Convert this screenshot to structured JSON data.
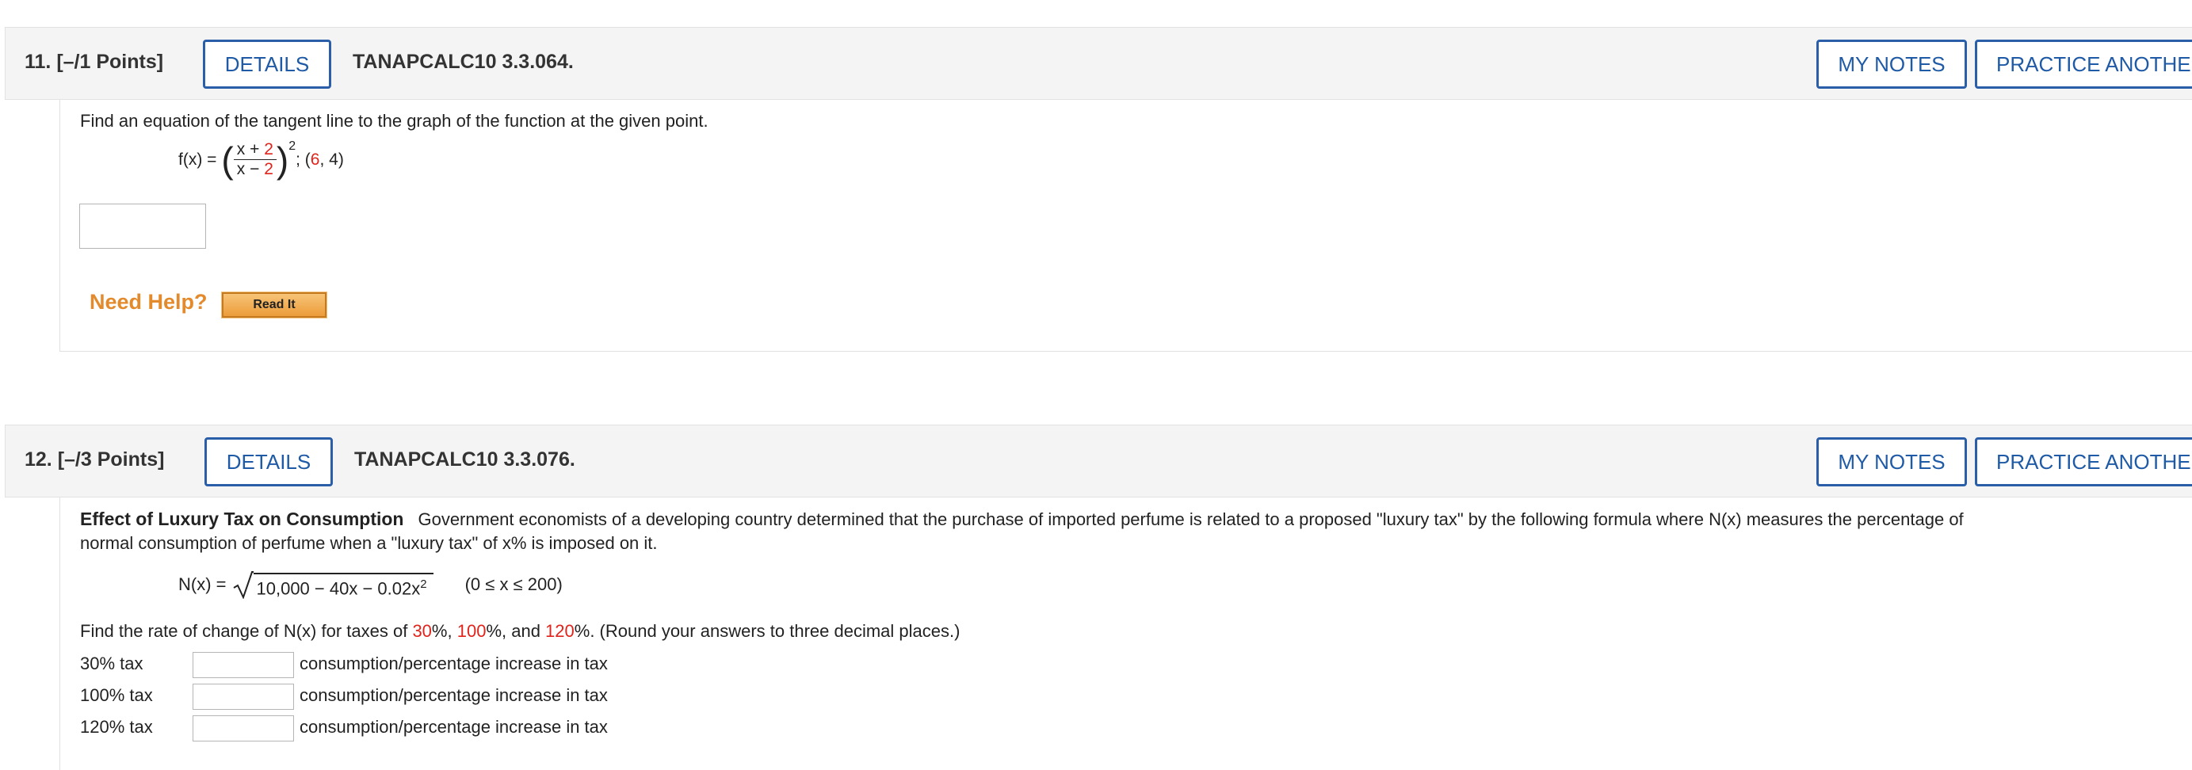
{
  "q11": {
    "number_points": "11.  [–/1 Points]",
    "details_label": "DETAILS",
    "code": "TANAPCALC10 3.3.064.",
    "my_notes_label": "MY NOTES",
    "practice_label": "PRACTICE ANOTHER",
    "prompt": "Find an equation of the tangent line to the graph of the function at the given point.",
    "fx_label": "f(x) =",
    "num_var": "x +",
    "num_const": "2",
    "den_var": "x −",
    "den_const": "2",
    "exponent": "2",
    "point_prefix": "; (",
    "point_x": "6",
    "point_rest": ", 4)",
    "answer_value": "",
    "need_help_label": "Need Help?",
    "read_it_label": "Read It"
  },
  "q12": {
    "number_points": "12.  [–/3 Points]",
    "details_label": "DETAILS",
    "code": "TANAPCALC10 3.3.076.",
    "my_notes_label": "MY NOTES",
    "practice_label": "PRACTICE ANOTHER",
    "title": "Effect of Luxury Tax on Consumption",
    "desc_line1": "Government economists of a developing country determined that the purchase of imported perfume is related to a proposed \"luxury tax\" by the following formula where N(x) measures the percentage of",
    "desc_line2": "normal consumption of perfume when a \"luxury tax\" of x% is imposed on it.",
    "nx_label": "N(x) =",
    "radicand": "10,000 − 40x − 0.02x",
    "radicand_exp": "2",
    "domain": "(0 ≤ x ≤ 200)",
    "rate_text_1": "Find the rate of change of N(x) for taxes of ",
    "rate_val_1": "30",
    "rate_text_2": "%, ",
    "rate_val_2": "100",
    "rate_text_3": "%, and ",
    "rate_val_3": "120",
    "rate_text_4": "%. (Round your answers to three decimal places.)",
    "rows": [
      {
        "label": "30% tax",
        "value": "",
        "unit": "consumption/percentage increase in tax"
      },
      {
        "label": "100% tax",
        "value": "",
        "unit": "consumption/percentage increase in tax"
      },
      {
        "label": "120% tax",
        "value": "",
        "unit": "consumption/percentage increase in tax"
      }
    ]
  }
}
